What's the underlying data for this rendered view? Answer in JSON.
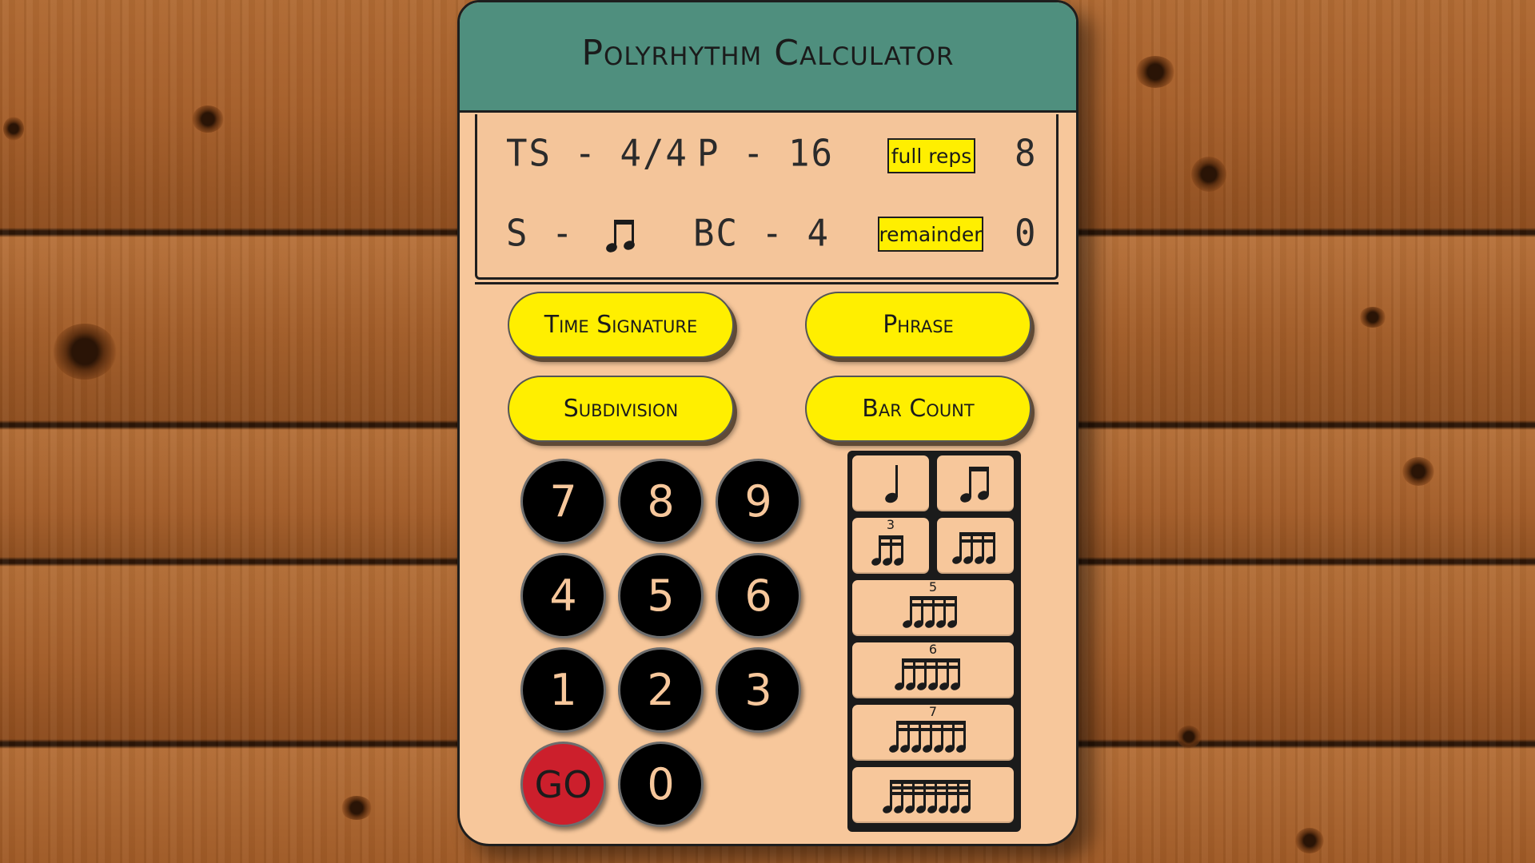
{
  "title": "Polyrhythm Calculator",
  "display": {
    "time_signature": "TS - 4/4",
    "phrase": "P - 16",
    "full_reps_label": "full reps",
    "full_reps_value": "8",
    "subdivision_prefix": "S -",
    "subdivision_icon": "eighth-notes-icon",
    "bar_count": "BC - 4",
    "remainder_label": "remainder",
    "remainder_value": "0"
  },
  "mode_buttons": {
    "time_signature": "Time Signature",
    "phrase": "Phrase",
    "subdivision": "Subdivision",
    "bar_count": "Bar Count"
  },
  "keypad": {
    "k7": "7",
    "k8": "8",
    "k9": "9",
    "k4": "4",
    "k5": "5",
    "k6": "6",
    "k1": "1",
    "k2": "2",
    "k3": "3",
    "go": "GO",
    "k0": "0"
  },
  "note_buttons": {
    "triplet_number": "3",
    "quintuplet_number": "5",
    "sextuplet_number": "6",
    "septuplet_number": "7"
  },
  "colors": {
    "body": "#f7c79b",
    "header": "#4f8f7e",
    "accent_yellow": "#ffef00",
    "key_black": "#000000",
    "go_red": "#cc1f2c"
  }
}
